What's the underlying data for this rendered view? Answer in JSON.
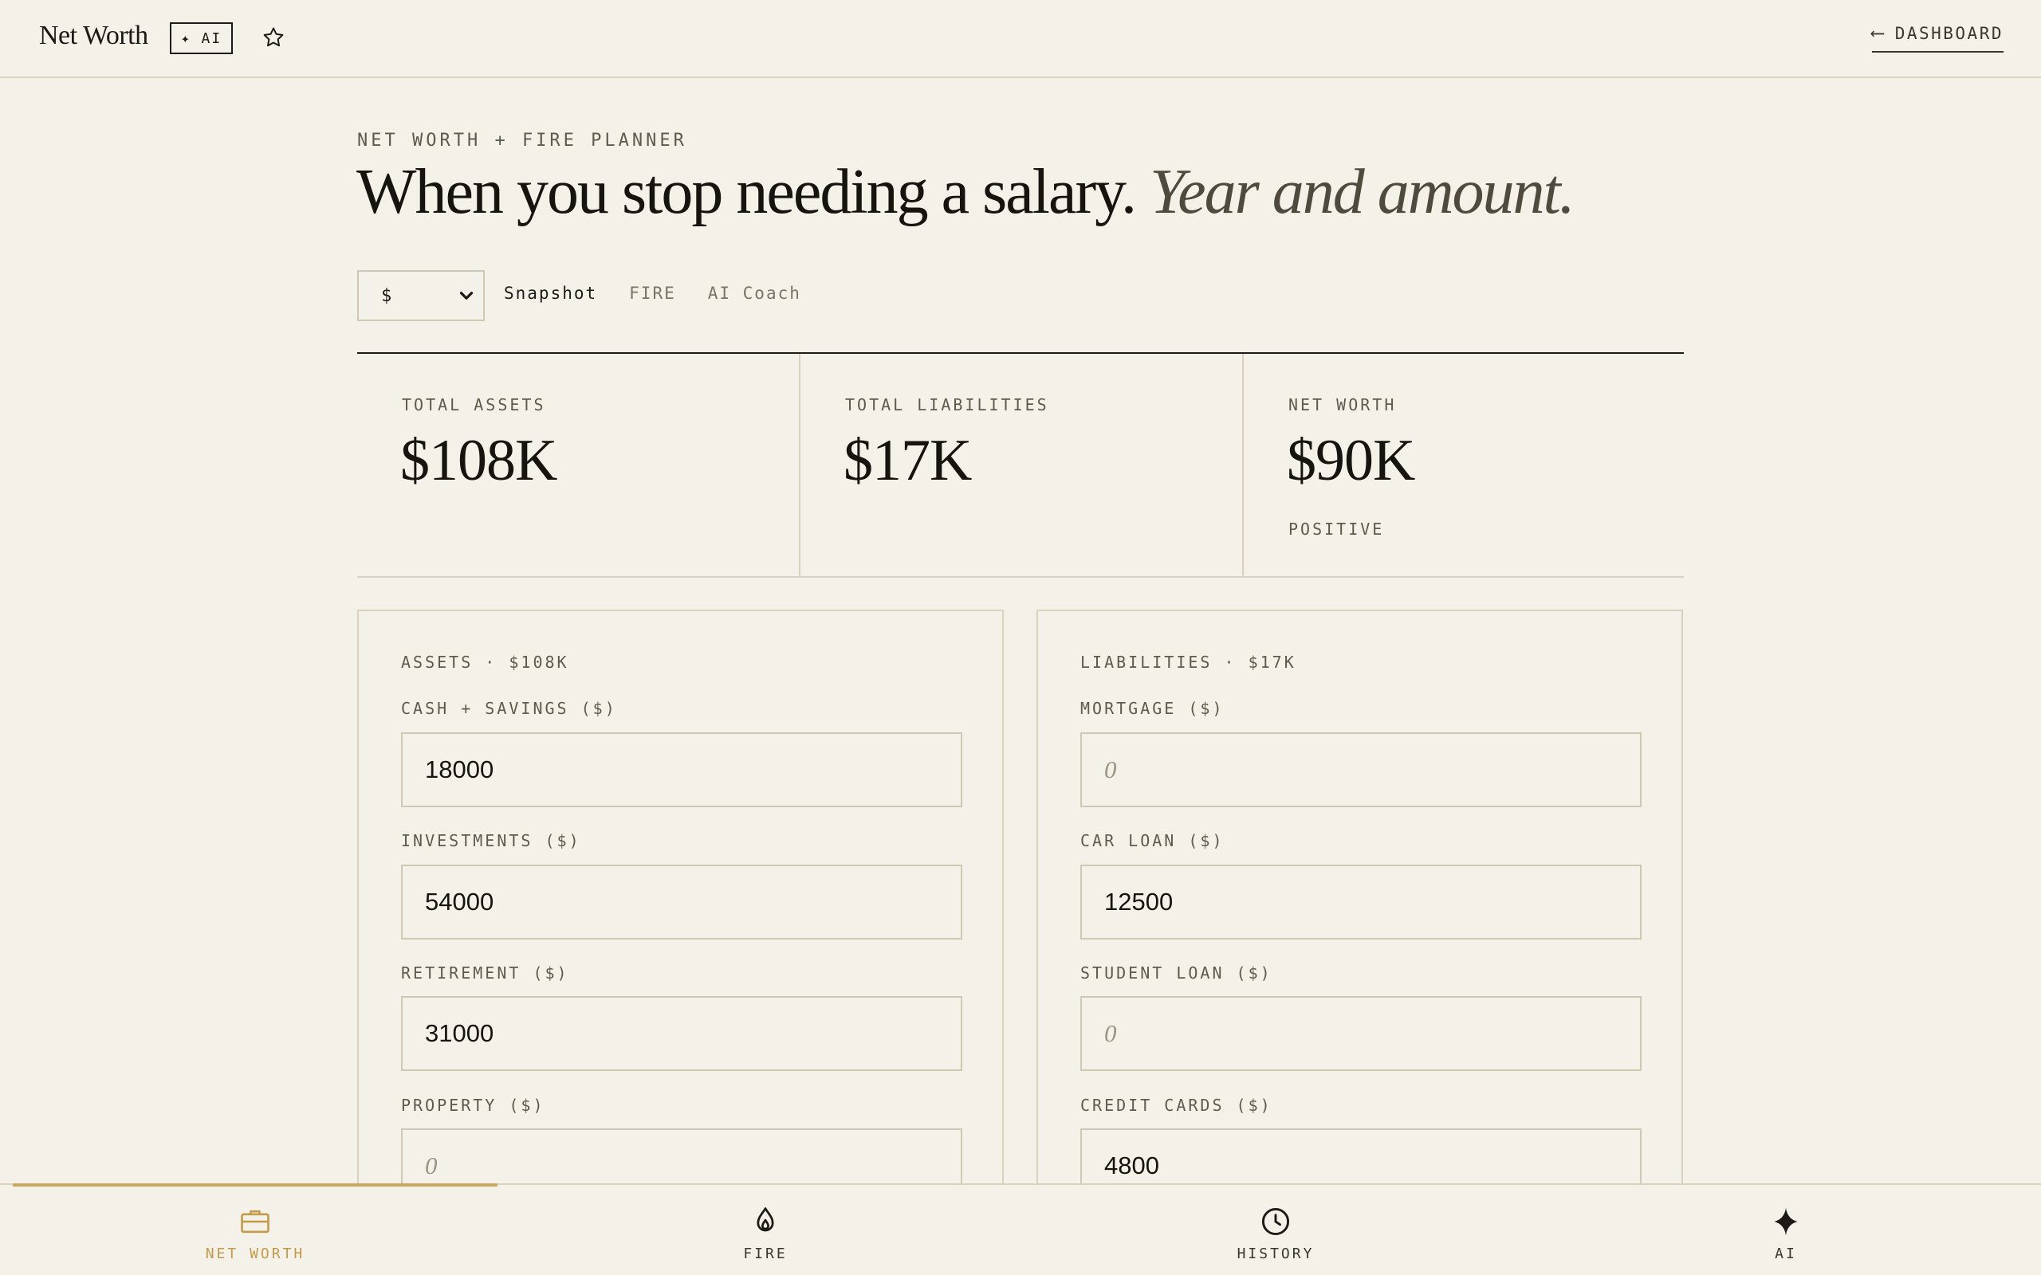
{
  "header": {
    "app_title": "Net Worth",
    "ai_badge": "✦ AI",
    "dashboard_link": "DASHBOARD",
    "back_arrow": "⟵"
  },
  "hero": {
    "eyebrow": "NET WORTH + FIRE PLANNER",
    "headline": "When you stop needing a salary.",
    "headline_italic": "Year and amount."
  },
  "controls": {
    "currency": "$",
    "tabs": [
      {
        "label": "Snapshot",
        "active": true
      },
      {
        "label": "FIRE",
        "active": false
      },
      {
        "label": "AI Coach",
        "active": false
      }
    ]
  },
  "summary": {
    "assets": {
      "label": "TOTAL ASSETS",
      "value": "$108K"
    },
    "liabilities": {
      "label": "TOTAL LIABILITIES",
      "value": "$17K"
    },
    "net_worth": {
      "label": "NET WORTH",
      "value": "$90K",
      "note": "POSITIVE"
    }
  },
  "assets_panel": {
    "heading": "ASSETS · $108K",
    "fields": [
      {
        "label": "CASH + SAVINGS ($)",
        "value": "18000",
        "placeholder": "0"
      },
      {
        "label": "INVESTMENTS ($)",
        "value": "54000",
        "placeholder": "0"
      },
      {
        "label": "RETIREMENT ($)",
        "value": "31000",
        "placeholder": "0"
      },
      {
        "label": "PROPERTY ($)",
        "value": "",
        "placeholder": "0"
      }
    ]
  },
  "liabilities_panel": {
    "heading": "LIABILITIES · $17K",
    "fields": [
      {
        "label": "MORTGAGE ($)",
        "value": "",
        "placeholder": "0"
      },
      {
        "label": "CAR LOAN ($)",
        "value": "12500",
        "placeholder": "0"
      },
      {
        "label": "STUDENT LOAN ($)",
        "value": "",
        "placeholder": "0"
      },
      {
        "label": "CREDIT CARDS ($)",
        "value": "4800",
        "placeholder": "0"
      }
    ]
  },
  "bottom_nav": {
    "items": [
      {
        "label": "NET WORTH",
        "icon": "briefcase-icon",
        "active": true
      },
      {
        "label": "FIRE",
        "icon": "flame-icon",
        "active": false
      },
      {
        "label": "HISTORY",
        "icon": "clock-icon",
        "active": false
      },
      {
        "label": "AI",
        "icon": "sparkle-icon",
        "active": false
      }
    ]
  },
  "colors": {
    "background": "#f4f1e8",
    "accent": "#c39a48",
    "text": "#16140f",
    "border": "#d8d2bf"
  }
}
